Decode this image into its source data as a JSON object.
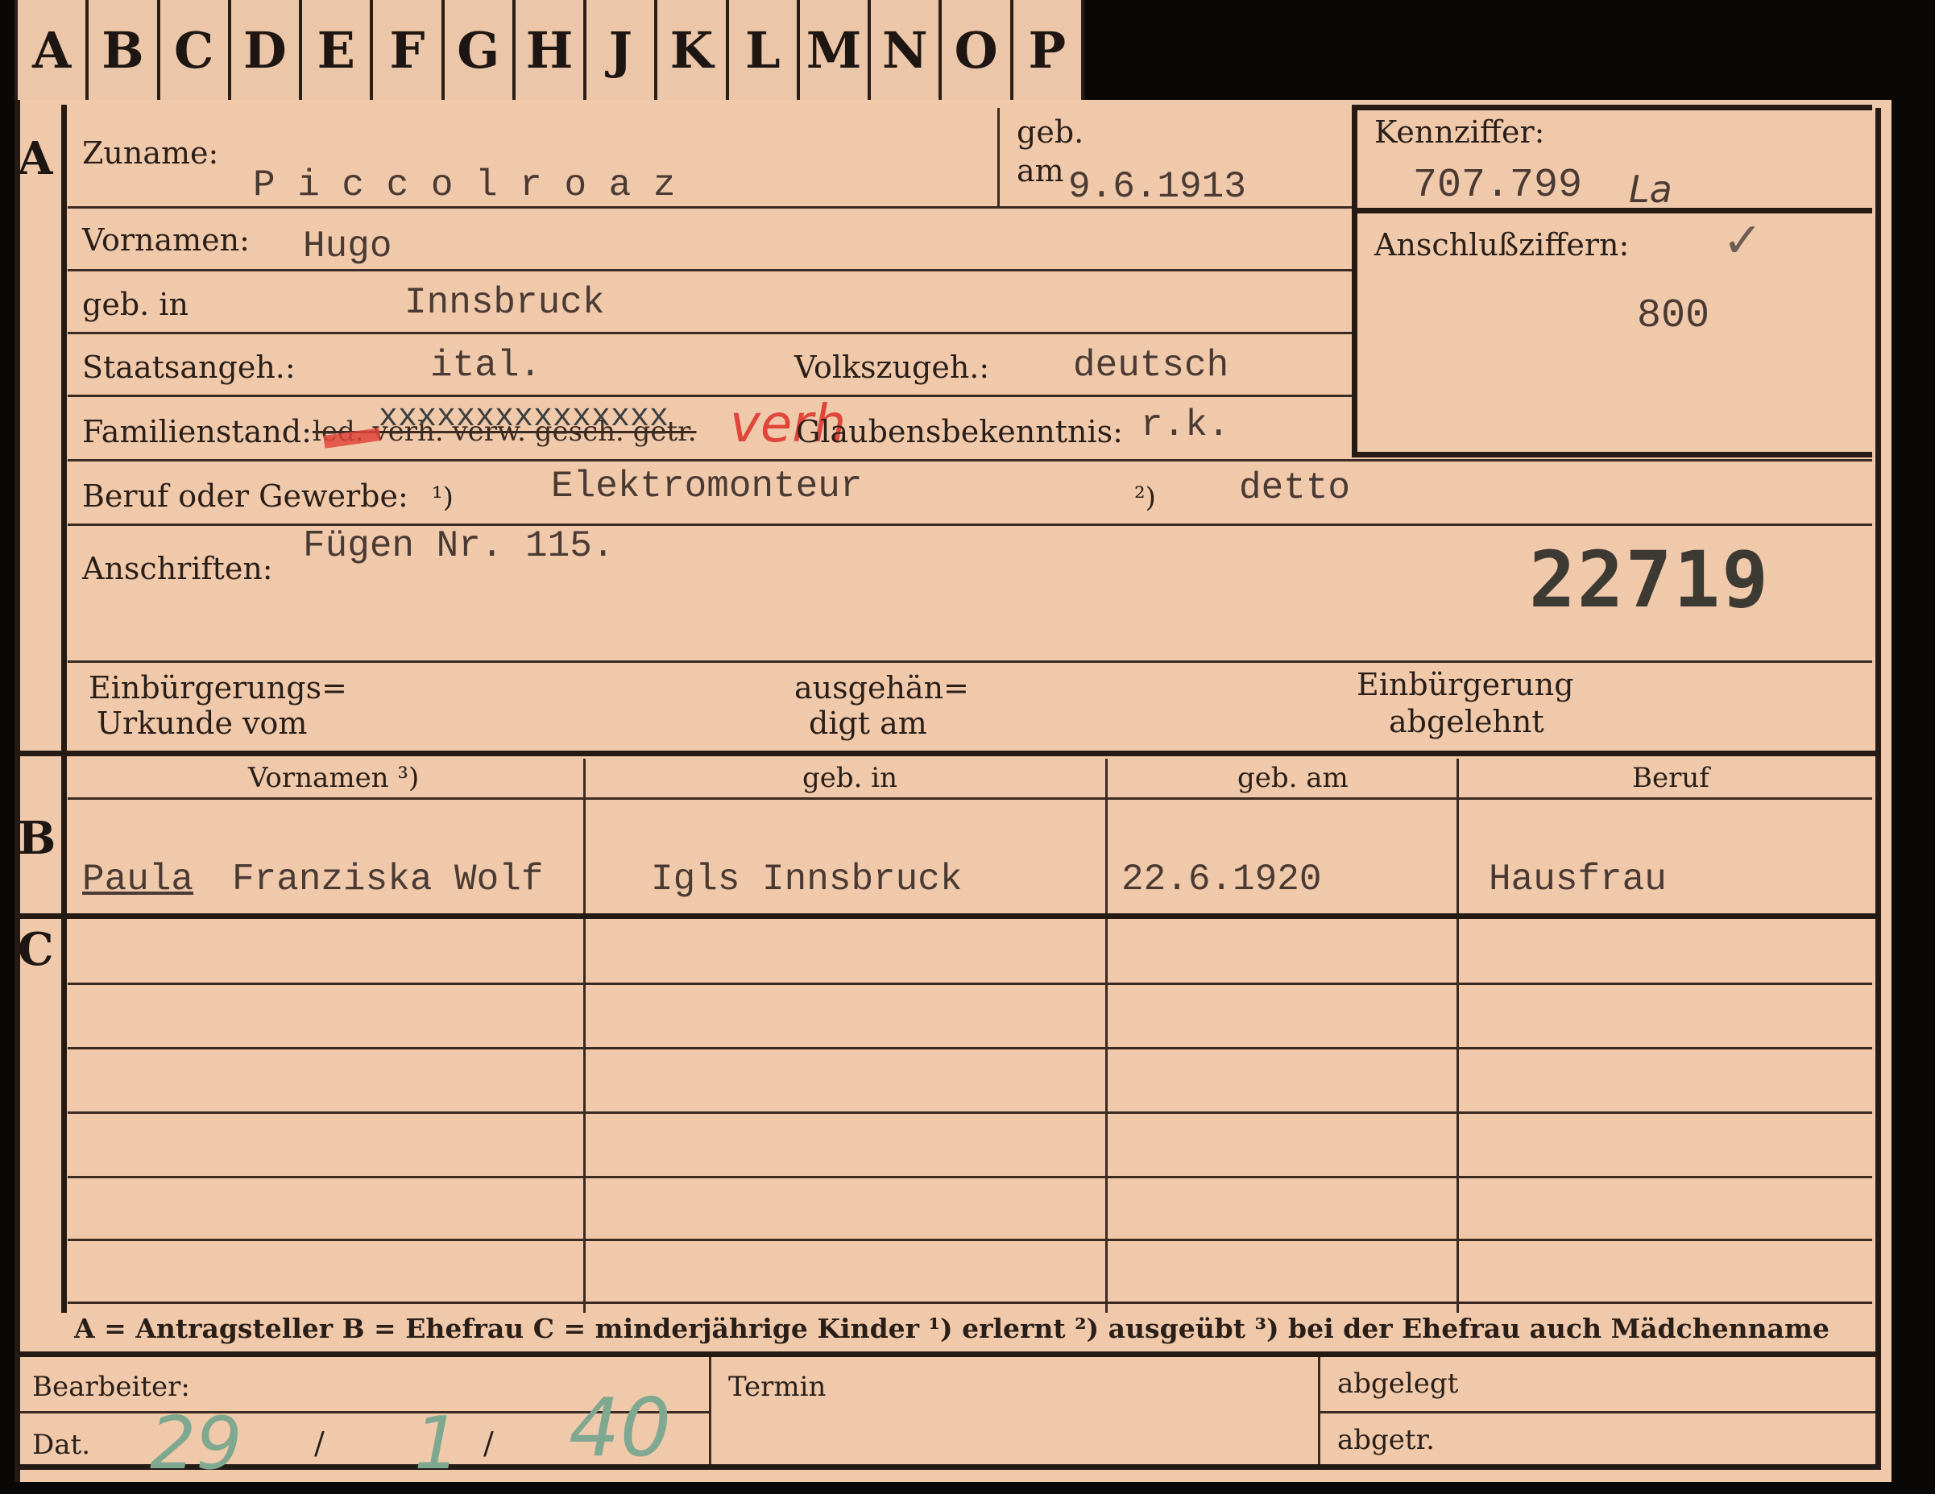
{
  "tabs": [
    "A",
    "B",
    "C",
    "D",
    "E",
    "F",
    "G",
    "H",
    "J",
    "K",
    "L",
    "M",
    "N",
    "O",
    "P"
  ],
  "sections": {
    "a": "A",
    "b": "B",
    "c": "C"
  },
  "labels": {
    "zuname": "Zuname:",
    "geb_am_1": "geb.",
    "geb_am_2": "am",
    "vornamen": "Vornamen:",
    "geb_in": "geb. in",
    "staatsangeh": "Staatsangeh.:",
    "volkszugeh": "Volkszugeh.:",
    "familienstand": "Familienstand:",
    "familienstand_options": "led. verh. verw. gesch. getr.",
    "glaubensbekenntnis": "Glaubensbekenntnis:",
    "beruf": "Beruf oder Gewerbe:",
    "fn1": "¹)",
    "fn2": "²)",
    "anschriften": "Anschriften:",
    "kennziffer": "Kennziffer:",
    "anschlussziffern": "Anschlußziffern:",
    "einb_urkunde_1": "Einbürgerungs=",
    "einb_urkunde_2": "Urkunde vom",
    "ausgehaendigt_1": "ausgehän=",
    "ausgehaendigt_2": "digt am",
    "einb_abgelehnt_1": "Einbürgerung",
    "einb_abgelehnt_2": "abgelehnt",
    "col_vornamen": "Vornamen ³)",
    "col_geb_in": "geb. in",
    "col_geb_am": "geb. am",
    "col_beruf": "Beruf",
    "legend": "A = Antragsteller   B = Ehefrau   C = minderjährige Kinder   ¹) erlernt   ²) ausgeübt   ³) bei der Ehefrau auch Mädchenname",
    "bearbeiter": "Bearbeiter:",
    "dat": "Dat.",
    "termin": "Termin",
    "abgelegt": "abgelegt",
    "abgetr": "abgetr."
  },
  "values": {
    "zuname": "P i c c o l r o a z",
    "geb_am": "9.6.1913",
    "vornamen": "Hugo",
    "geb_in": "Innsbruck",
    "staatsangeh": "ital.",
    "volkszugeh": "deutsch",
    "familienstand_x": "xxxxxxxxxxxxxxx",
    "familienstand_hand": "verh",
    "glaubensbekenntnis": "r.k.",
    "beruf_erlernt": "Elektromonteur",
    "beruf_ausgeuebt": "detto",
    "anschriften": "Fügen Nr. 115.",
    "stamp_number": "22719",
    "kennziffer": "707.799",
    "kennziffer_suffix": "La",
    "check": "✓",
    "anschlussziffern": "800",
    "ehefrau": {
      "vornamen_first": "Paula",
      "vornamen_rest": "Franziska Wolf",
      "geb_in": "Igls Innsbruck",
      "geb_am": "22.6.1920",
      "beruf": "Hausfrau"
    },
    "dat_day": "29",
    "dat_sep": "/",
    "dat_month": "1",
    "dat_year": "40"
  },
  "colors": {
    "card": "#f0c9ab",
    "ink": "#2a1f18",
    "typewriter": "#4a3a33",
    "red_pencil": "#e0453a",
    "green_pencil": "#7fa890"
  }
}
